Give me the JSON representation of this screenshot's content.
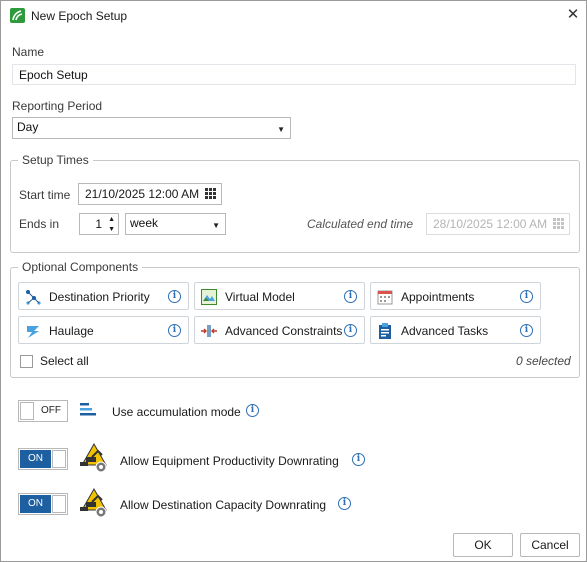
{
  "window": {
    "title": "New Epoch Setup",
    "close_glyph": "✕"
  },
  "name": {
    "label": "Name",
    "value": "Epoch Setup"
  },
  "reporting_period": {
    "label": "Reporting Period",
    "selected": "Day"
  },
  "setup_times": {
    "title": "Setup Times",
    "start_label": "Start time",
    "start_value": "21/10/2025 12:00 AM",
    "ends_label": "Ends in",
    "ends_count": "1",
    "ends_unit": "week",
    "calc_label": "Calculated end time",
    "calc_value": "28/10/2025 12:00 AM"
  },
  "optional_components": {
    "title": "Optional Components",
    "items": [
      {
        "label": "Destination Priority",
        "icon": "destination-priority-icon"
      },
      {
        "label": "Virtual Model",
        "icon": "virtual-model-icon"
      },
      {
        "label": "Appointments",
        "icon": "appointments-icon"
      },
      {
        "label": "Haulage",
        "icon": "haulage-icon"
      },
      {
        "label": "Advanced Constraints",
        "icon": "advanced-constraints-icon"
      },
      {
        "label": "Advanced Tasks",
        "icon": "advanced-tasks-icon"
      }
    ],
    "select_all_label": "Select all",
    "selected_count": "0 selected"
  },
  "options": [
    {
      "label": "Use accumulation mode",
      "state": "OFF"
    },
    {
      "label": "Allow Equipment Productivity Downrating",
      "state": "ON"
    },
    {
      "label": "Allow Destination Capacity Downrating",
      "state": "ON"
    }
  ],
  "buttons": {
    "ok": "OK",
    "cancel": "Cancel"
  },
  "colors": {
    "accent": "#1d5fa0",
    "info": "#2d6fb5",
    "brand": "#2e9a3c"
  }
}
